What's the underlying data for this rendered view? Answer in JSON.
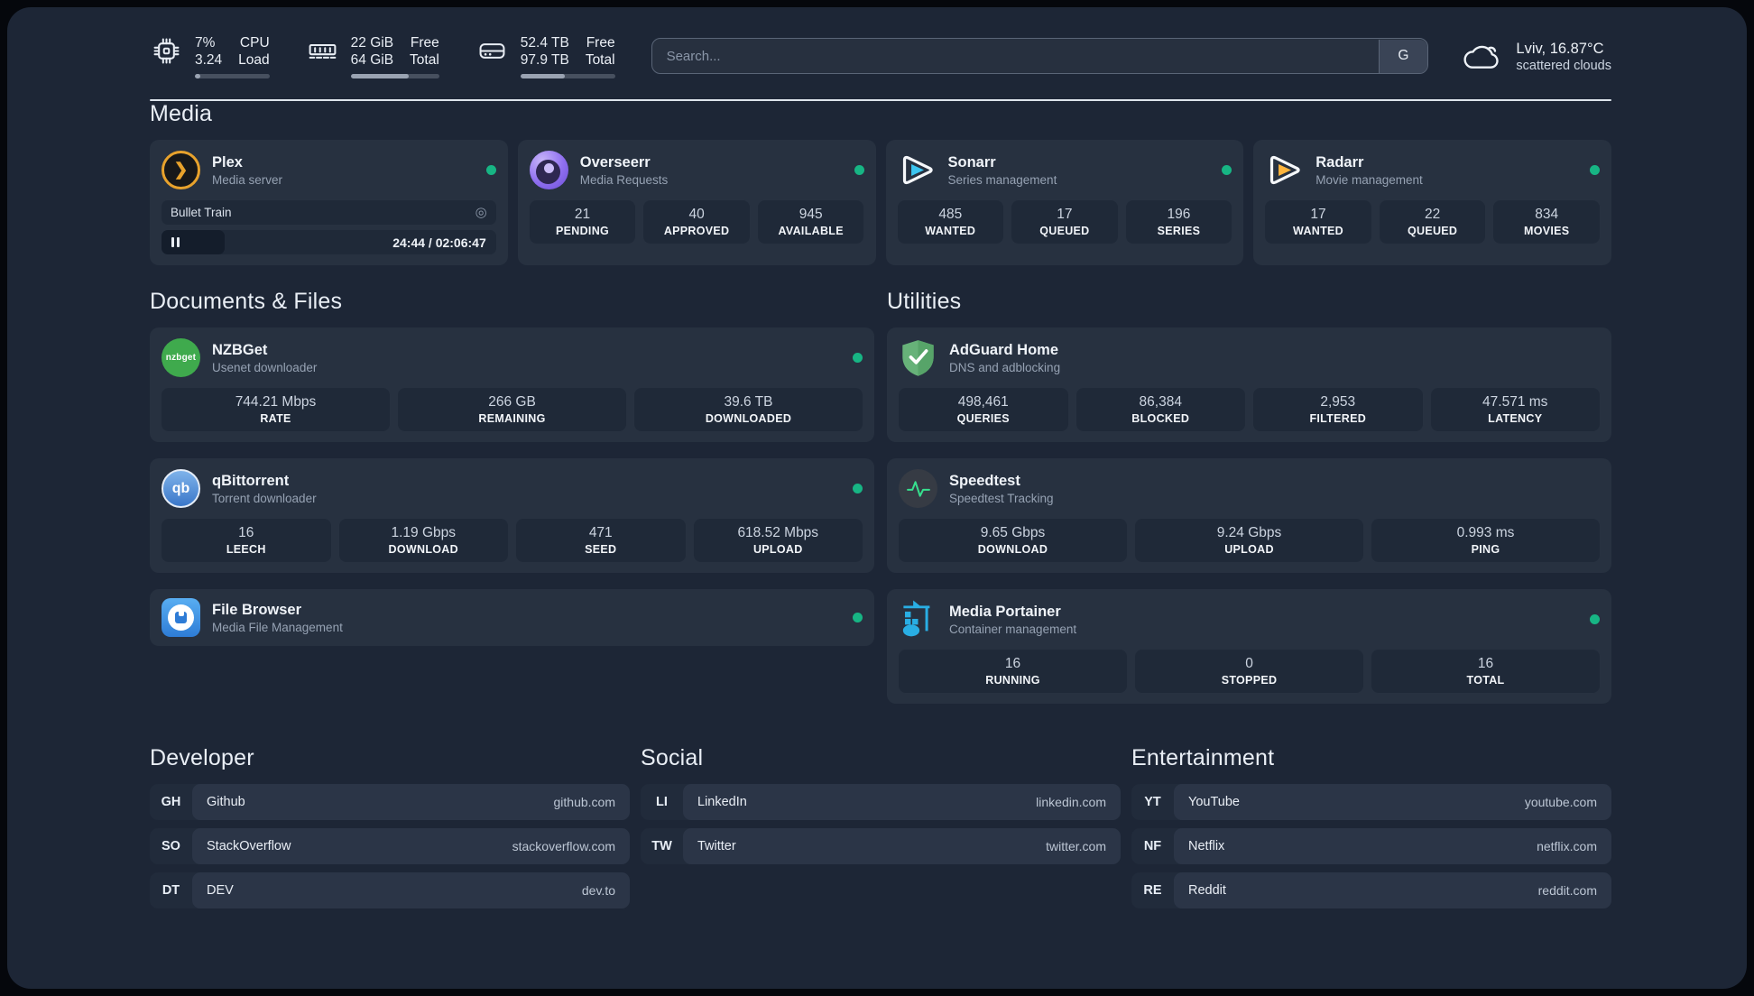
{
  "system_metrics": [
    {
      "name": "cpu",
      "line1": "7%",
      "line2": "3.24",
      "label1": "CPU",
      "label2": "Load",
      "progress": 7
    },
    {
      "name": "ram",
      "line1": "22 GiB",
      "line2": "64 GiB",
      "label1": "Free",
      "label2": "Total",
      "progress": 66
    },
    {
      "name": "disk",
      "line1": "52.4 TB",
      "line2": "97.9 TB",
      "label1": "Free",
      "label2": "Total",
      "progress": 47
    }
  ],
  "search": {
    "placeholder": "Search...",
    "provider_button": "G"
  },
  "weather": {
    "location": "Lviv, 16.87°C",
    "condition": "scattered clouds"
  },
  "sections": {
    "media": {
      "title": "Media",
      "cards": [
        {
          "title": "Plex",
          "subtitle": "Media server",
          "online": true,
          "player": {
            "track": "Bullet Train",
            "time": "24:44 / 02:06:47",
            "progress": 19
          }
        },
        {
          "title": "Overseerr",
          "subtitle": "Media Requests",
          "online": true,
          "stats": [
            {
              "value": "21",
              "label": "PENDING"
            },
            {
              "value": "40",
              "label": "APPROVED"
            },
            {
              "value": "945",
              "label": "AVAILABLE"
            }
          ]
        },
        {
          "title": "Sonarr",
          "subtitle": "Series management",
          "online": true,
          "stats": [
            {
              "value": "485",
              "label": "WANTED"
            },
            {
              "value": "17",
              "label": "QUEUED"
            },
            {
              "value": "196",
              "label": "SERIES"
            }
          ]
        },
        {
          "title": "Radarr",
          "subtitle": "Movie management",
          "online": true,
          "stats": [
            {
              "value": "17",
              "label": "WANTED"
            },
            {
              "value": "22",
              "label": "QUEUED"
            },
            {
              "value": "834",
              "label": "MOVIES"
            }
          ]
        }
      ]
    },
    "documents": {
      "title": "Documents & Files",
      "cards": [
        {
          "title": "NZBGet",
          "subtitle": "Usenet downloader",
          "online": true,
          "icon_text": "nzbget",
          "stats": [
            {
              "value": "744.21 Mbps",
              "label": "RATE"
            },
            {
              "value": "266 GB",
              "label": "REMAINING"
            },
            {
              "value": "39.6 TB",
              "label": "DOWNLOADED"
            }
          ]
        },
        {
          "title": "qBittorrent",
          "subtitle": "Torrent downloader",
          "online": true,
          "icon_text": "qb",
          "stats": [
            {
              "value": "16",
              "label": "LEECH"
            },
            {
              "value": "1.19 Gbps",
              "label": "DOWNLOAD"
            },
            {
              "value": "471",
              "label": "SEED"
            },
            {
              "value": "618.52 Mbps",
              "label": "UPLOAD"
            }
          ]
        },
        {
          "title": "File Browser",
          "subtitle": "Media File Management",
          "online": true
        }
      ]
    },
    "utilities": {
      "title": "Utilities",
      "cards": [
        {
          "title": "AdGuard Home",
          "subtitle": "DNS and adblocking",
          "online": false,
          "stats": [
            {
              "value": "498,461",
              "label": "QUERIES"
            },
            {
              "value": "86,384",
              "label": "BLOCKED"
            },
            {
              "value": "2,953",
              "label": "FILTERED"
            },
            {
              "value": "47.571 ms",
              "label": "LATENCY"
            }
          ]
        },
        {
          "title": "Speedtest",
          "subtitle": "Speedtest Tracking",
          "online": false,
          "stats": [
            {
              "value": "9.65 Gbps",
              "label": "DOWNLOAD"
            },
            {
              "value": "9.24 Gbps",
              "label": "UPLOAD"
            },
            {
              "value": "0.993 ms",
              "label": "PING"
            }
          ]
        },
        {
          "title": "Media Portainer",
          "subtitle": "Container management",
          "online": true,
          "stats": [
            {
              "value": "16",
              "label": "RUNNING"
            },
            {
              "value": "0",
              "label": "STOPPED"
            },
            {
              "value": "16",
              "label": "TOTAL"
            }
          ]
        }
      ]
    },
    "bookmarks": [
      {
        "title": "Developer",
        "links": [
          {
            "tag": "GH",
            "name": "Github",
            "url": "github.com"
          },
          {
            "tag": "SO",
            "name": "StackOverflow",
            "url": "stackoverflow.com"
          },
          {
            "tag": "DT",
            "name": "DEV",
            "url": "dev.to"
          }
        ]
      },
      {
        "title": "Social",
        "links": [
          {
            "tag": "LI",
            "name": "LinkedIn",
            "url": "linkedin.com"
          },
          {
            "tag": "TW",
            "name": "Twitter",
            "url": "twitter.com"
          }
        ]
      },
      {
        "title": "Entertainment",
        "links": [
          {
            "tag": "YT",
            "name": "YouTube",
            "url": "youtube.com"
          },
          {
            "tag": "NF",
            "name": "Netflix",
            "url": "netflix.com"
          },
          {
            "tag": "RE",
            "name": "Reddit",
            "url": "reddit.com"
          }
        ]
      }
    ]
  },
  "colors": {
    "status_online": "#17b584",
    "plex_amber": "#e8a22c",
    "sonarr_cyan": "#3cc5f0",
    "radarr_amber": "#ffb53c",
    "adguard_green": "#67b279",
    "portainer_blue": "#29aee4",
    "speedtest_pulse": "#36e08e",
    "nzbget_green": "#3faa4d",
    "qbittorrent_blue": "#3a77c9",
    "filebrowser_blue": "#2e7cd6",
    "overseerr_purple": "#8f6ff0"
  }
}
